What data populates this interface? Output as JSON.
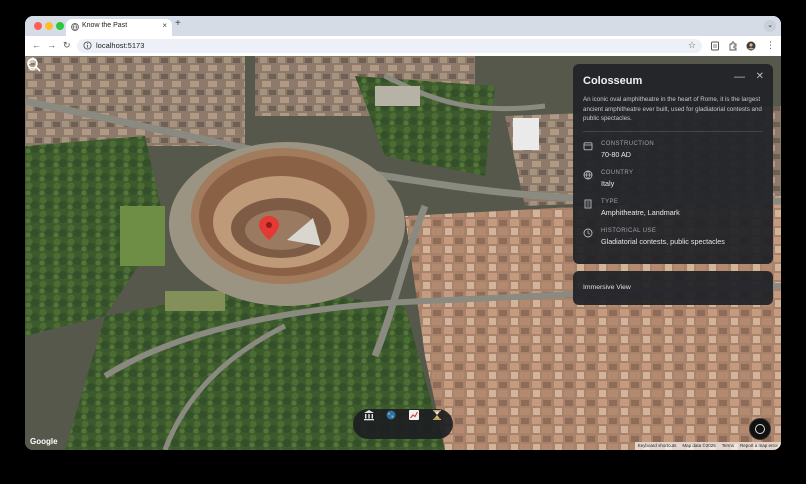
{
  "browser": {
    "tab_title": "Know the Past",
    "tab_close": "×",
    "new_tab": "+",
    "url": "localhost:5173",
    "tab_menu": "⌄"
  },
  "map": {
    "google_label": "Google",
    "attribution": [
      "Keyboard shortcuts",
      "Map data ©2025",
      "Terms",
      "Report a map error"
    ]
  },
  "panel": {
    "title": "Colosseum",
    "description": "An iconic oval amphitheatre in the heart of Rome, it is the largest ancient amphitheatre ever built, used for gladiatorial contests and public spectacles.",
    "fields": [
      {
        "label": "CONSTRUCTION",
        "value": "70-80 AD",
        "icon": "calendar-icon"
      },
      {
        "label": "COUNTRY",
        "value": "Italy",
        "icon": "globe-icon"
      },
      {
        "label": "TYPE",
        "value": "Amphitheatre, Landmark",
        "icon": "building-icon"
      },
      {
        "label": "HISTORICAL USE",
        "value": "Gladiatorial contests, public spectacles",
        "icon": "clock-icon"
      }
    ],
    "immersive_label": "Immersive View"
  },
  "bottom_toolbar": {
    "icons": [
      "museum-icon",
      "globe-icon",
      "chart-icon",
      "hourglass-icon"
    ]
  },
  "colors": {
    "panel_bg": "#212328",
    "marker": "#e53935",
    "traffic_red": "#ff5f57",
    "traffic_yellow": "#febc2e",
    "traffic_green": "#28c840"
  }
}
